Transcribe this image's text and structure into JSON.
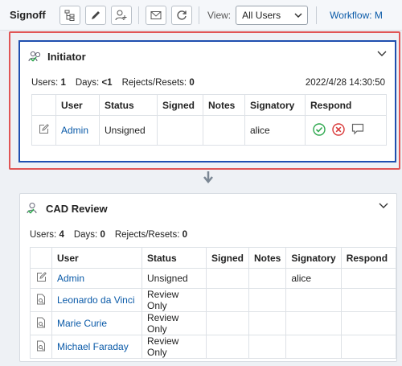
{
  "toolbar": {
    "title": "Signoff",
    "view_label": "View:",
    "view_value": "All Users",
    "workflow_link": "Workflow: M"
  },
  "initiator": {
    "title": "Initiator",
    "users_label": "Users:",
    "users_value": "1",
    "days_label": "Days:",
    "days_value": "<1",
    "rejects_label": "Rejects/Resets:",
    "rejects_value": "0",
    "date": "2022/4/28 14:30:50",
    "columns": [
      "User",
      "Status",
      "Signed",
      "Notes",
      "Signatory",
      "Respond"
    ],
    "rows": [
      {
        "user": "Admin",
        "status": "Unsigned",
        "signed": "",
        "notes": "",
        "signatory": "alice"
      }
    ]
  },
  "cad_review": {
    "title": "CAD Review",
    "users_label": "Users:",
    "users_value": "4",
    "days_label": "Days:",
    "days_value": "0",
    "rejects_label": "Rejects/Resets:",
    "rejects_value": "0",
    "columns": [
      "User",
      "Status",
      "Signed",
      "Notes",
      "Signatory",
      "Respond"
    ],
    "rows": [
      {
        "user": "Admin",
        "status": "Unsigned",
        "signed": "",
        "notes": "",
        "signatory": "alice"
      },
      {
        "user": "Leonardo da Vinci",
        "status": "Review Only",
        "signed": "",
        "notes": "",
        "signatory": ""
      },
      {
        "user": "Marie Curie",
        "status": "Review Only",
        "signed": "",
        "notes": "",
        "signatory": ""
      },
      {
        "user": "Michael Faraday",
        "status": "Review Only",
        "signed": "",
        "notes": "",
        "signatory": ""
      }
    ]
  },
  "colors": {
    "link": "#0a5aa8",
    "highlight_red": "#e05555",
    "highlight_blue": "#1f4fb0",
    "approve": "#2fa84f",
    "reject": "#d93a3a"
  }
}
